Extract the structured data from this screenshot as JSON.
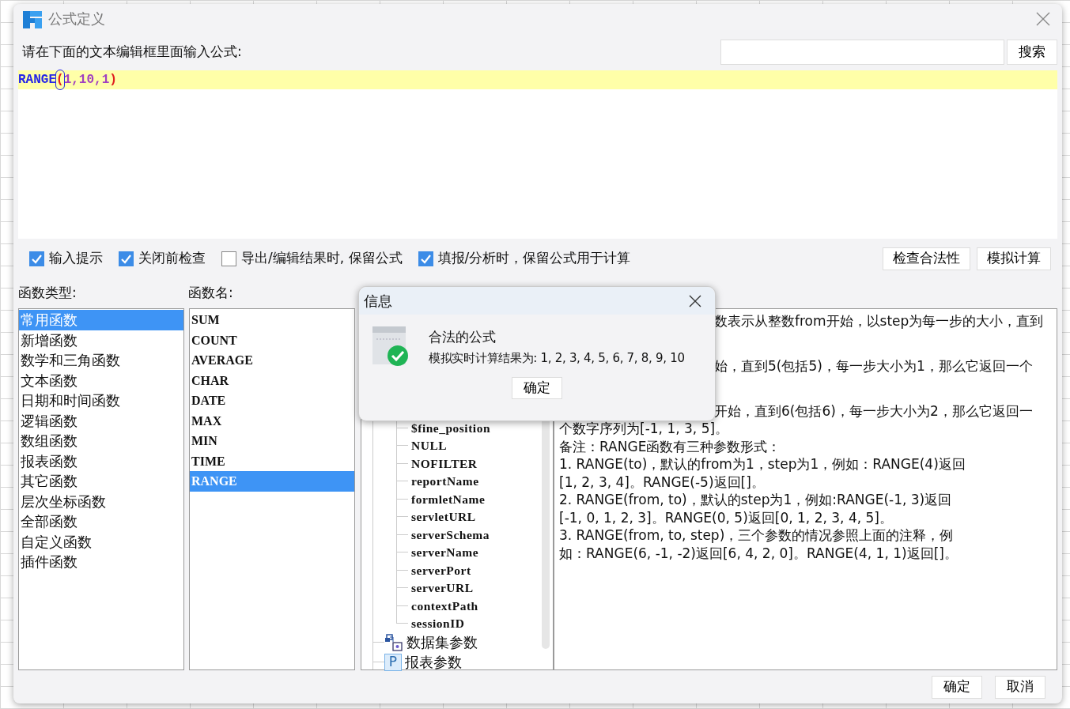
{
  "window": {
    "title": "公式定义"
  },
  "prompt": "请在下面的文本编辑框里面输入公式:",
  "search": {
    "button": "搜索"
  },
  "editor": {
    "tokens": [
      {
        "text": "RANGE",
        "kind": "function",
        "matched": false
      },
      {
        "text": "(",
        "kind": "paren",
        "matched": true
      },
      {
        "text": "1,10,1",
        "kind": "args",
        "matched": false
      },
      {
        "text": ")",
        "kind": "paren",
        "matched": false
      }
    ]
  },
  "checkboxes": [
    {
      "label": "输入提示",
      "checked": true
    },
    {
      "label": "关闭前检查",
      "checked": true
    },
    {
      "label": "导出/编辑结果时, 保留公式",
      "checked": false
    },
    {
      "label": "填报/分析时，保留公式用于计算",
      "checked": true
    }
  ],
  "actions": [
    "检查合法性",
    "模拟计算"
  ],
  "categories_label": "函数类型:",
  "functions_label": "函数名:",
  "categories": [
    {
      "label": "常用函数",
      "selected": true
    },
    {
      "label": "新增函数",
      "selected": false
    },
    {
      "label": "数学和三角函数",
      "selected": false
    },
    {
      "label": "文本函数",
      "selected": false
    },
    {
      "label": "日期和时间函数",
      "selected": false
    },
    {
      "label": "逻辑函数",
      "selected": false
    },
    {
      "label": "数组函数",
      "selected": false
    },
    {
      "label": "报表函数",
      "selected": false
    },
    {
      "label": "其它函数",
      "selected": false
    },
    {
      "label": "层次坐标函数",
      "selected": false
    },
    {
      "label": "全部函数",
      "selected": false
    },
    {
      "label": "自定义函数",
      "selected": false
    },
    {
      "label": "插件函数",
      "selected": false
    }
  ],
  "functions": [
    {
      "label": "SUM",
      "selected": false
    },
    {
      "label": "COUNT",
      "selected": false
    },
    {
      "label": "AVERAGE",
      "selected": false
    },
    {
      "label": "CHAR",
      "selected": false
    },
    {
      "label": "DATE",
      "selected": false
    },
    {
      "label": "MAX",
      "selected": false
    },
    {
      "label": "MIN",
      "selected": false
    },
    {
      "label": "TIME",
      "selected": false
    },
    {
      "label": "RANGE",
      "selected": true
    }
  ],
  "tree": {
    "items": [
      {
        "children": [
          {
            "label": "$fine_position"
          },
          {
            "label": "NULL"
          },
          {
            "label": "NOFILTER"
          },
          {
            "label": "reportName"
          },
          {
            "label": "formletName"
          },
          {
            "label": "servletURL"
          },
          {
            "label": "serverSchema"
          },
          {
            "label": "serverName"
          },
          {
            "label": "serverPort"
          },
          {
            "label": "serverURL"
          },
          {
            "label": "contextPath"
          },
          {
            "label": "sessionID"
          }
        ]
      },
      {
        "label": "数据集参数",
        "kind": "dataset"
      },
      {
        "label": "报表参数",
        "kind": "parameter",
        "icon_letter": "P"
      }
    ]
  },
  "description": {
    "partial_lines": [
      "数表示从整数from开始，以step为每一步的大小，直到",
      "始，直到5(包括5)，每一步大小为1，那么它返回一个",
      "开始，直到6(包括6)，每一步大小为2，那么它返回一"
    ],
    "lines": [
      "个数字序列为[-1, 1, 3, 5]。",
      "备注：RANGE函数有三种参数形式：",
      "1.  RANGE(to)，默认的from为1，step为1，例如：RANGE(4)返回",
      "[1, 2, 3, 4]。RANGE(-5)返回[]。",
      "2.  RANGE(from, to)，默认的step为1，例如:RANGE(-1, 3)返回",
      "[-1, 0, 1, 2, 3]。RANGE(0, 5)返回[0, 1, 2, 3, 4, 5]。",
      "3.  RANGE(from, to, step)，三个参数的情况参照上面的注释，例",
      "如：RANGE(6, -1, -2)返回[6, 4, 2, 0]。RANGE(4, 1, 1)返回[]。"
    ]
  },
  "footer": [
    "确定",
    "取消"
  ],
  "info_dialog": {
    "title": "信息",
    "message": "合法的公式",
    "result": "模拟实时计算结果为: 1, 2, 3, 4, 5, 6, 7, 8, 9, 10",
    "button": "确定"
  }
}
